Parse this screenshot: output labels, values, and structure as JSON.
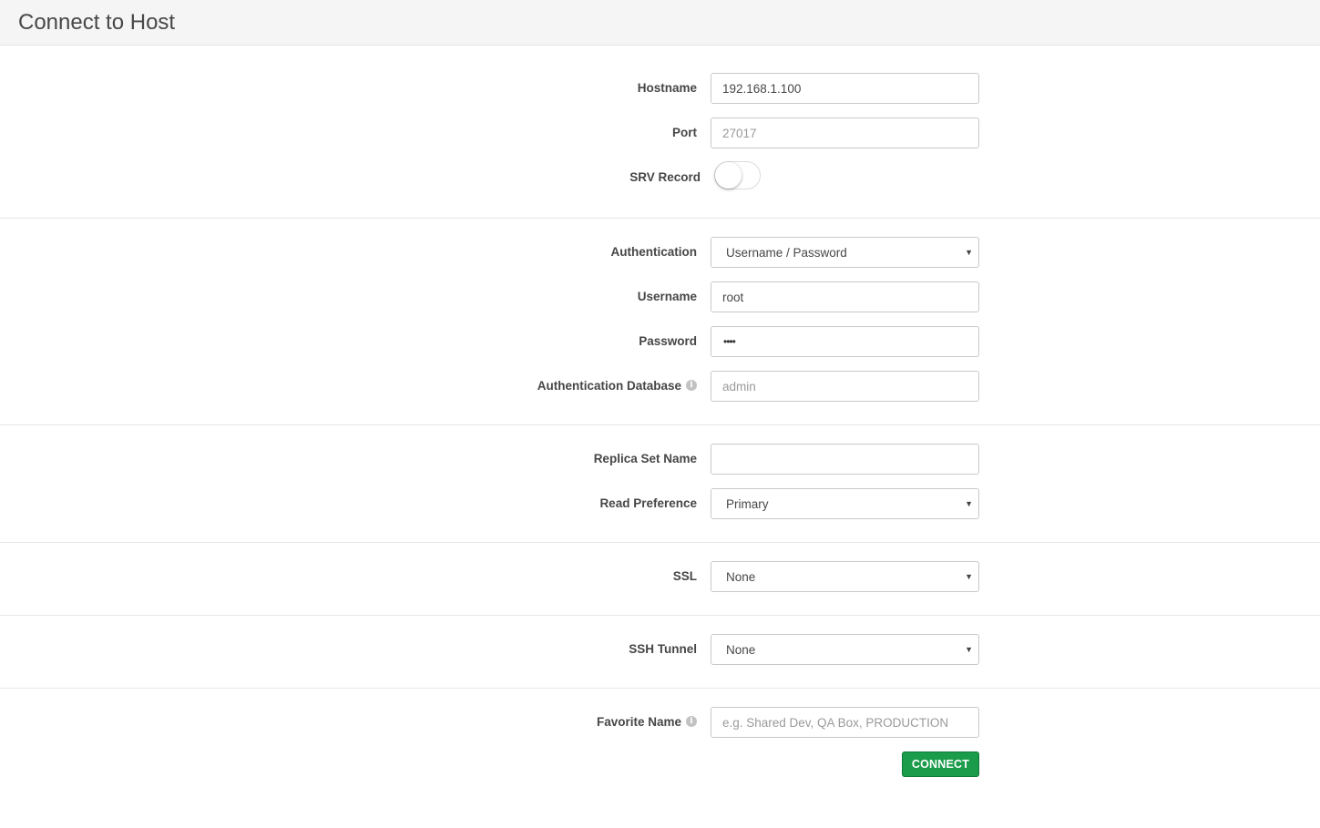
{
  "header": {
    "title": "Connect to Host"
  },
  "form": {
    "hostname": {
      "label": "Hostname",
      "value": "192.168.1.100"
    },
    "port": {
      "label": "Port",
      "placeholder": "27017"
    },
    "srv_record": {
      "label": "SRV Record",
      "enabled": false
    },
    "authentication": {
      "label": "Authentication",
      "selected": "Username / Password"
    },
    "username": {
      "label": "Username",
      "value": "root"
    },
    "password": {
      "label": "Password",
      "masked": "••••"
    },
    "auth_database": {
      "label": "Authentication Database",
      "placeholder": "admin"
    },
    "replica_set": {
      "label": "Replica Set Name",
      "value": ""
    },
    "read_preference": {
      "label": "Read Preference",
      "selected": "Primary"
    },
    "ssl": {
      "label": "SSL",
      "selected": "None"
    },
    "ssh_tunnel": {
      "label": "SSH Tunnel",
      "selected": "None"
    },
    "favorite_name": {
      "label": "Favorite Name",
      "placeholder": "e.g. Shared Dev, QA Box, PRODUCTION"
    },
    "connect_label": "CONNECT"
  },
  "icons": {
    "info": "info-icon",
    "dropdown": "chevron-down-icon"
  },
  "colors": {
    "accent": "#1a9c4b",
    "header_bg": "#f5f5f5"
  }
}
